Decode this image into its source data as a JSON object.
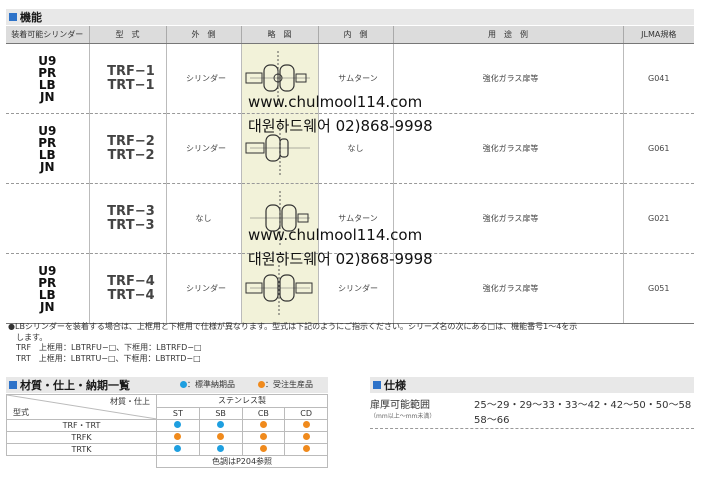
{
  "section_function": {
    "title": "機能"
  },
  "table": {
    "headers": [
      "装着可能シリンダー",
      "型　式",
      "外　側",
      "略　図",
      "内　側",
      "用　途　例",
      "JLMA規格"
    ],
    "rows": [
      {
        "mounts": [
          "U9",
          "PR",
          "LB",
          "JN"
        ],
        "models": [
          "TRF−1",
          "TRT−1"
        ],
        "outside": "シリンダー",
        "inside": "サムターン",
        "usage": "強化ガラス扉等",
        "jlma": "G041"
      },
      {
        "mounts": [
          "U9",
          "PR",
          "LB",
          "JN"
        ],
        "models": [
          "TRF−2",
          "TRT−2"
        ],
        "outside": "シリンダー",
        "inside": "なし",
        "usage": "強化ガラス扉等",
        "jlma": "G061"
      },
      {
        "mounts": [],
        "models": [
          "TRF−3",
          "TRT−3"
        ],
        "outside": "なし",
        "inside": "サムターン",
        "usage": "強化ガラス扉等",
        "jlma": "G021"
      },
      {
        "mounts": [
          "U9",
          "PR",
          "LB",
          "JN"
        ],
        "models": [
          "TRF−4",
          "TRT−4"
        ],
        "outside": "シリンダー",
        "inside": "シリンダー",
        "usage": "強化ガラス扉等",
        "jlma": "G051"
      }
    ]
  },
  "watermark": {
    "url": "www.chulmool114.com",
    "phone": "대원하드웨어 02)868-9998"
  },
  "notes": [
    "●LBシリンダーを装着する場合は、上框用と下框用で仕様が異なります。型式は下記のようにご指示ください。シリーズ名の次にある□は、機能番号1〜4を示",
    "します。",
    "TRF　上框用：LBTRFU−□、下框用：LBTRFD−□",
    "TRT　上框用：LBTRTU−□、下框用：LBTRTD−□"
  ],
  "section_material": {
    "title": "材質・仕上・納期一覧"
  },
  "legend": {
    "standard": "：標準納期品",
    "order": "：受注生産品",
    "standard_color": "#1e9fe0",
    "order_color": "#f08a1c"
  },
  "material_table": {
    "header_left_top": "材質・仕上",
    "header_left_bottom": "型式",
    "material": "ステンレス製",
    "finishes": [
      "ST",
      "SB",
      "CB",
      "CD"
    ],
    "rows": [
      {
        "model": "TRF・TRT",
        "dots": [
          "standard",
          "standard",
          "order",
          "order"
        ]
      },
      {
        "model": "TRFK",
        "dots": [
          "order",
          "order",
          "order",
          "order"
        ]
      },
      {
        "model": "TRTK",
        "dots": [
          "standard",
          "standard",
          "order",
          "order"
        ]
      }
    ],
    "footnote": "色調はP204参照"
  },
  "section_spec": {
    "title": "仕様"
  },
  "spec": {
    "label": "扉厚可能範囲",
    "sublabel": "（mm以上〜mm未満）",
    "values_line1": "25〜29・29〜33・33〜42・42〜50・50〜58",
    "values_line2": "58〜66"
  }
}
